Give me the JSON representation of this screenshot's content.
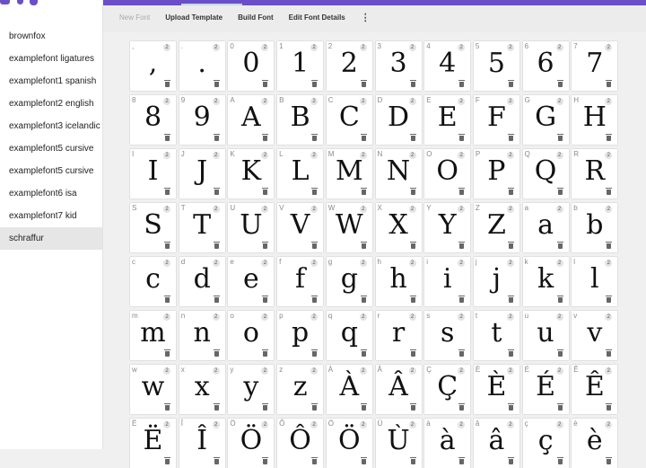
{
  "sidebar": {
    "fonts": [
      {
        "label": "brownfox",
        "selected": false
      },
      {
        "label": "examplefont ligatures",
        "selected": false
      },
      {
        "label": "examplefont1 spanish",
        "selected": false
      },
      {
        "label": "examplefont2 english",
        "selected": false
      },
      {
        "label": "examplefont3 icelandic",
        "selected": false
      },
      {
        "label": "examplefont5 cursive",
        "selected": false
      },
      {
        "label": "examplefont5 cursive",
        "selected": false
      },
      {
        "label": "examplefont6 isa",
        "selected": false
      },
      {
        "label": "examplefont7 kid",
        "selected": false
      },
      {
        "label": "schraffur",
        "selected": true
      }
    ]
  },
  "toolbar": {
    "new_font": "New Font",
    "upload_template": "Upload Template",
    "build_font": "Build Font",
    "edit_font_details": "Edit Font Details",
    "more_icon": "more-vertical-icon"
  },
  "colors": {
    "accent": "#6b4fc8"
  },
  "glyphs": [
    [
      ",",
      ",",
      "2"
    ],
    [
      ".",
      ".",
      "2"
    ],
    [
      "0",
      "0",
      "2"
    ],
    [
      "1",
      "1",
      "2"
    ],
    [
      "2",
      "2",
      "2"
    ],
    [
      "3",
      "3",
      "2"
    ],
    [
      "4",
      "4",
      "2"
    ],
    [
      "5",
      "5",
      "2"
    ],
    [
      "6",
      "6",
      "2"
    ],
    [
      "7",
      "7",
      "2"
    ],
    [
      "8",
      "8",
      "2"
    ],
    [
      "9",
      "9",
      "2"
    ],
    [
      "A",
      "A",
      "2"
    ],
    [
      "B",
      "B",
      "2"
    ],
    [
      "C",
      "C",
      "2"
    ],
    [
      "D",
      "D",
      "2"
    ],
    [
      "E",
      "E",
      "2"
    ],
    [
      "F",
      "F",
      "2"
    ],
    [
      "G",
      "G",
      "2"
    ],
    [
      "H",
      "H",
      "2"
    ],
    [
      "I",
      "I",
      "2"
    ],
    [
      "J",
      "J",
      "2"
    ],
    [
      "K",
      "K",
      "2"
    ],
    [
      "L",
      "L",
      "2"
    ],
    [
      "M",
      "M",
      "2"
    ],
    [
      "N",
      "N",
      "2"
    ],
    [
      "O",
      "O",
      "2"
    ],
    [
      "P",
      "P",
      "2"
    ],
    [
      "Q",
      "Q",
      "2"
    ],
    [
      "R",
      "R",
      "2"
    ],
    [
      "S",
      "S",
      "2"
    ],
    [
      "T",
      "T",
      "2"
    ],
    [
      "U",
      "U",
      "2"
    ],
    [
      "V",
      "V",
      "2"
    ],
    [
      "W",
      "W",
      "2"
    ],
    [
      "X",
      "X",
      "2"
    ],
    [
      "Y",
      "Y",
      "2"
    ],
    [
      "Z",
      "Z",
      "2"
    ],
    [
      "a",
      "a",
      "2"
    ],
    [
      "b",
      "b",
      "2"
    ],
    [
      "c",
      "c",
      "2"
    ],
    [
      "d",
      "d",
      "2"
    ],
    [
      "e",
      "e",
      "2"
    ],
    [
      "f",
      "f",
      "2"
    ],
    [
      "g",
      "g",
      "2"
    ],
    [
      "h",
      "h",
      "2"
    ],
    [
      "i",
      "i",
      "2"
    ],
    [
      "j",
      "j",
      "2"
    ],
    [
      "k",
      "k",
      "2"
    ],
    [
      "l",
      "l",
      "2"
    ],
    [
      "m",
      "m",
      "2"
    ],
    [
      "n",
      "n",
      "2"
    ],
    [
      "o",
      "o",
      "2"
    ],
    [
      "p",
      "p",
      "2"
    ],
    [
      "q",
      "q",
      "2"
    ],
    [
      "r",
      "r",
      "2"
    ],
    [
      "s",
      "s",
      "2"
    ],
    [
      "t",
      "t",
      "2"
    ],
    [
      "u",
      "u",
      "2"
    ],
    [
      "v",
      "v",
      "2"
    ],
    [
      "w",
      "w",
      "2"
    ],
    [
      "x",
      "x",
      "2"
    ],
    [
      "y",
      "y",
      "2"
    ],
    [
      "z",
      "z",
      "2"
    ],
    [
      "À",
      "À",
      "2"
    ],
    [
      "Â",
      "Â",
      "2"
    ],
    [
      "Ç",
      "Ç",
      "2"
    ],
    [
      "È",
      "È",
      "2"
    ],
    [
      "É",
      "É",
      "2"
    ],
    [
      "Ê",
      "Ê",
      "2"
    ],
    [
      "Ë",
      "Ë",
      "2"
    ],
    [
      "Î",
      "Î",
      "2"
    ],
    [
      "Ö",
      "Ö",
      "2"
    ],
    [
      "Ô",
      "Ô",
      "2"
    ],
    [
      "Ö",
      "Ö",
      "2"
    ],
    [
      "Ù",
      "Ù",
      "2"
    ],
    [
      "à",
      "à",
      "2"
    ],
    [
      "â",
      "â",
      "2"
    ],
    [
      "ç",
      "ç",
      "2"
    ],
    [
      "è",
      "è",
      "2"
    ]
  ]
}
